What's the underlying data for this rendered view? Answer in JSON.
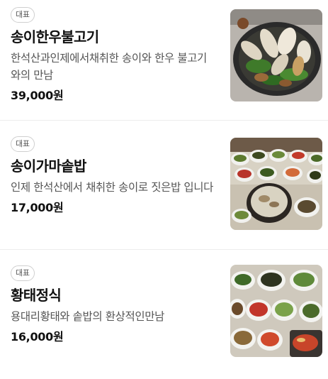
{
  "menu": {
    "items": [
      {
        "badge": "대표",
        "name": "송이한우불고기",
        "description": "한석산과인제에서채취한 송이와 한우 불고기와의 만남",
        "price": "39,000원",
        "photo_subject": "bulgogi-hot-plate-with-mushrooms"
      },
      {
        "badge": "대표",
        "name": "송이가마솥밥",
        "description": "인제 한석산에서 채취한 송이로 짓은밥 입니다",
        "price": "17,000원",
        "photo_subject": "pot-rice-with-side-dishes"
      },
      {
        "badge": "대표",
        "name": "황태정식",
        "description": "용대리황태와 솥밥의 환상적인만남",
        "price": "16,000원",
        "photo_subject": "pollack-set-meal-side-dishes"
      }
    ]
  },
  "colors": {
    "name_text": "#111111",
    "desc_text": "#555555",
    "badge_border": "#cfcfcf",
    "divider": "#ececec"
  }
}
